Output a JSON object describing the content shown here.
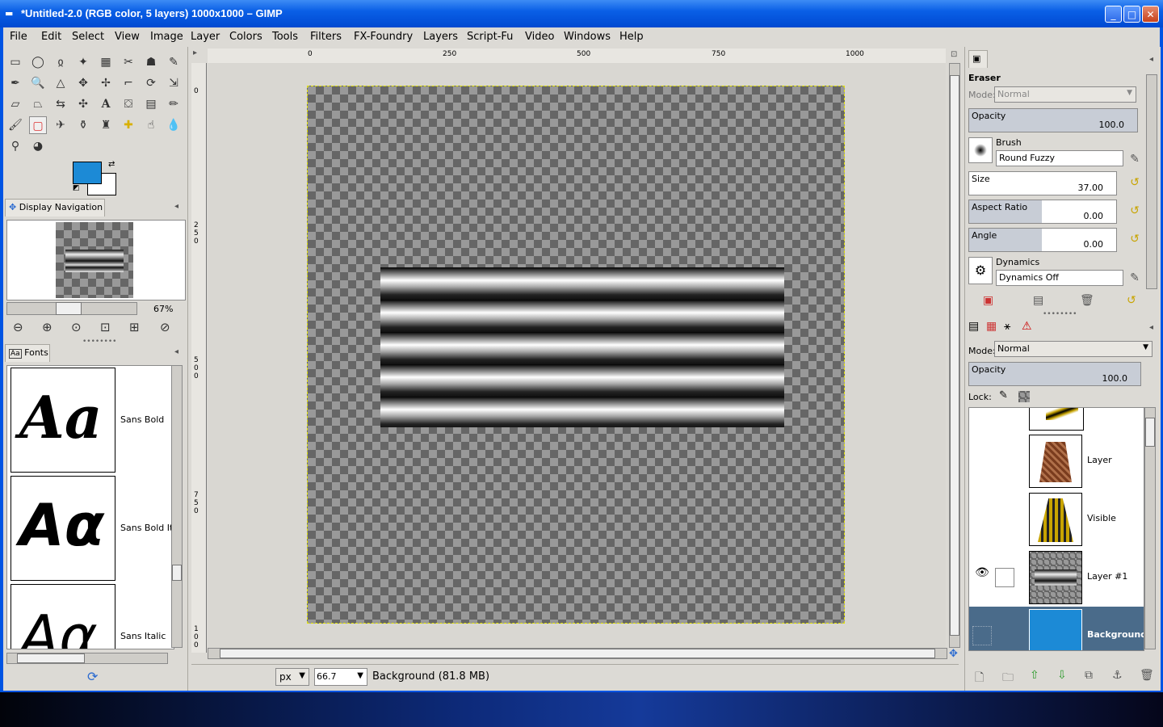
{
  "window": {
    "title": "*Untitled-2.0 (RGB color, 5 layers) 1000x1000 – GIMP",
    "buttons": [
      "minimize",
      "maximize",
      "close"
    ]
  },
  "menubar": [
    "File",
    "Edit",
    "Select",
    "View",
    "Image",
    "Layer",
    "Colors",
    "Tools",
    "Filters",
    "FX-Foundry",
    "Layers",
    "Script-Fu",
    "Video",
    "Windows",
    "Help"
  ],
  "toolbox": {
    "tools": [
      "rect-select",
      "ellipse-select",
      "free-select",
      "fuzzy-select",
      "color-select",
      "scissors",
      "foreground-select",
      "paths",
      "color-picker",
      "zoom",
      "measure",
      "move",
      "align",
      "crop",
      "rotate",
      "scale",
      "shear",
      "perspective",
      "flip",
      "cage",
      "text",
      "bucket-fill",
      "blend",
      "pencil",
      "paintbrush",
      "eraser",
      "airbrush",
      "ink",
      "clone",
      "heal",
      "smudge",
      "blur",
      "dodge-burn",
      "desaturate"
    ],
    "fg_color": "#1c8ad6",
    "bg_color": "#ffffff"
  },
  "navigation": {
    "tab_label": "Display Navigation",
    "zoom": "67%"
  },
  "fonts": {
    "tab_label": "Fonts",
    "items": [
      {
        "sample": "Aa",
        "name": "Sans Bold"
      },
      {
        "sample": "Aα",
        "name": "Sans Bold It"
      },
      {
        "sample": "Aα",
        "name": "Sans Italic"
      }
    ]
  },
  "rulers": {
    "top": [
      "0",
      "250",
      "500",
      "750",
      "1000"
    ],
    "left": [
      "0",
      "250",
      "500",
      "750",
      "100"
    ]
  },
  "status": {
    "unit": "px",
    "zoom": "66.7",
    "text": "Background (81.8 MB)"
  },
  "tool_options": {
    "tool_name": "Eraser",
    "mode_label": "Mode:",
    "mode_value": "Normal",
    "opacity_label": "Opacity",
    "opacity_value": "100.0",
    "brush_label": "Brush",
    "brush_value": "Round Fuzzy",
    "size_label": "Size",
    "size_value": "37.00",
    "aspect_label": "Aspect Ratio",
    "aspect_value": "0.00",
    "angle_label": "Angle",
    "angle_value": "0.00",
    "dynamics_label": "Dynamics",
    "dynamics_value": "Dynamics Off"
  },
  "layers": {
    "mode_label": "Mode:",
    "mode_value": "Normal",
    "opacity_label": "Opacity",
    "opacity_value": "100.0",
    "lock_label": "Lock:",
    "items": [
      {
        "name": "Layer",
        "visible": false
      },
      {
        "name": "Visible",
        "visible": false
      },
      {
        "name": "Layer #1",
        "visible": true
      },
      {
        "name": "Background",
        "visible": false,
        "selected": true
      }
    ]
  }
}
